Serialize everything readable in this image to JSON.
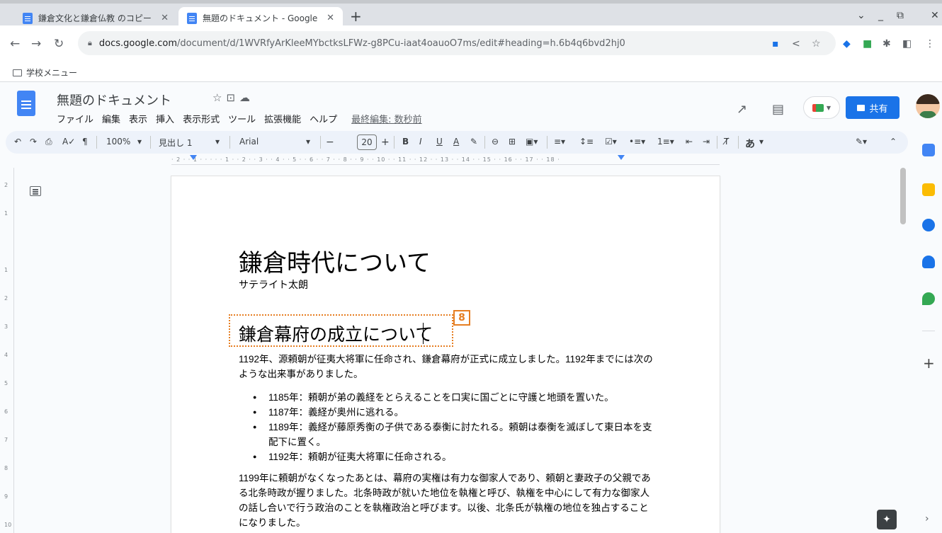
{
  "tabs": [
    {
      "label": "鎌倉文化と鎌倉仏教 のコピー"
    },
    {
      "label": "無題のドキュメント - Google"
    }
  ],
  "url": {
    "domain": "docs.google.com",
    "path": "/document/d/1WVRfyArKleeMYbctksLFWz-g8PCu-iaat4oauoO7ms/edit#heading=h.6b4q6bvd2hj0"
  },
  "bookmarks": {
    "folder_label": "学校メニュー"
  },
  "docs": {
    "title": "無題のドキュメント",
    "menus": [
      "ファイル",
      "編集",
      "表示",
      "挿入",
      "表示形式",
      "ツール",
      "拡張機能",
      "ヘルプ"
    ],
    "last_edit": "最終編集: 数秒前",
    "share_label": "共有"
  },
  "toolbar": {
    "zoom": "100%",
    "style": "見出し 1",
    "font": "Arial",
    "size": "20",
    "input_mode": "あ"
  },
  "ruler": {
    "ticks": "· 2 · · 1 · · · · · 1 · · 2 · · 3 · · 4 · · 5 · · 6 · · 7 · · 8 · · 9 · · 10 · · 11 · · 12 · · 13 · · 14 · · 15 · · 16 · · 17 · · 18 ·"
  },
  "document": {
    "title": "鎌倉時代について",
    "author": "サテライト太朗",
    "heading": "鎌倉幕府の成立について",
    "para1": "1192年、源頼朝が征夷大将軍に任命され、鎌倉幕府が正式に成立しました。1192年までには次のような出来事がありました。",
    "bullets": [
      "1185年：頼朝が弟の義経をとらえることを口実に国ごとに守護と地頭を置いた。",
      "1187年：義経が奥州に逃れる。",
      "1189年：義経が藤原秀衡の子供である泰衡に討たれる。頼朝は泰衡を滅ぼして東日本を支配下に置く。",
      "1192年：頼朝が征夷大将軍に任命される。"
    ],
    "para2": "1199年に頼朝がなくなったあとは、幕府の実権は有力な御家人であり、頼朝と妻政子の父親である北条時政が握りました。北条時政が就いた地位を執権と呼び、執権を中心にして有力な御家人の話し合いで行う政治のことを執権政治と呼びます。以後、北条氏が執権の地位を独占することになりました。"
  },
  "annotation": {
    "badge": "8",
    "color": "#e67e22"
  },
  "colors": {
    "accent": "#1a73e8",
    "doc_blue": "#4285f4"
  }
}
